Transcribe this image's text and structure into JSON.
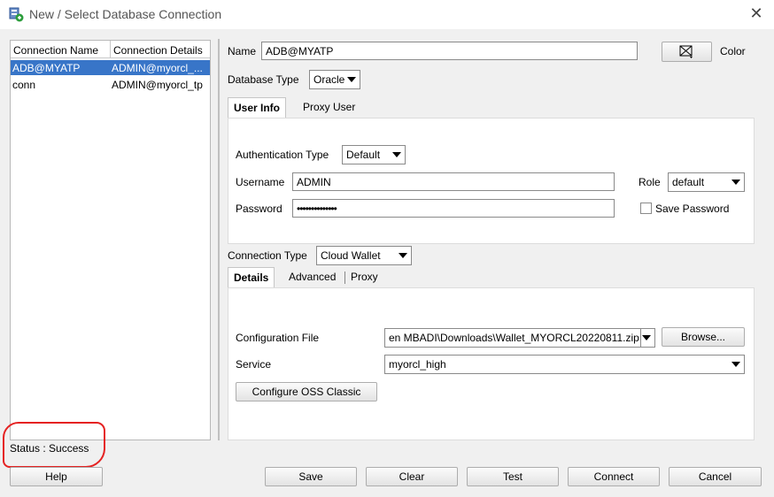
{
  "window": {
    "title": "New / Select Database Connection"
  },
  "list": {
    "headers": [
      "Connection Name",
      "Connection Details"
    ],
    "rows": [
      {
        "name": "ADB@MYATP",
        "details": "ADMIN@myorcl_..."
      },
      {
        "name": "conn",
        "details": "ADMIN@myorcl_tp"
      }
    ]
  },
  "status": "Status : Success",
  "form": {
    "name_label": "Name",
    "name_value": "ADB@MYATP",
    "color_label": "Color",
    "dbtype_label": "Database Type",
    "dbtype_value": "Oracle",
    "tabs": [
      "User Info",
      "Proxy User"
    ],
    "auth_label": "Authentication Type",
    "auth_value": "Default",
    "username_label": "Username",
    "username_value": "ADMIN",
    "role_label": "Role",
    "role_value": "default",
    "password_label": "Password",
    "password_value": "••••••••••••••",
    "save_password_label": "Save Password",
    "conntype_label": "Connection Type",
    "conntype_value": "Cloud Wallet",
    "subtabs": [
      "Details",
      "Advanced",
      "Proxy"
    ],
    "config_label": "Configuration File",
    "config_value": "en MBADI\\Downloads\\Wallet_MYORCL20220811.zip",
    "browse_label": "Browse...",
    "service_label": "Service",
    "service_value": "myorcl_high",
    "oss_label": "Configure OSS Classic"
  },
  "buttons": {
    "help": "Help",
    "save": "Save",
    "clear": "Clear",
    "test": "Test",
    "connect": "Connect",
    "cancel": "Cancel"
  }
}
